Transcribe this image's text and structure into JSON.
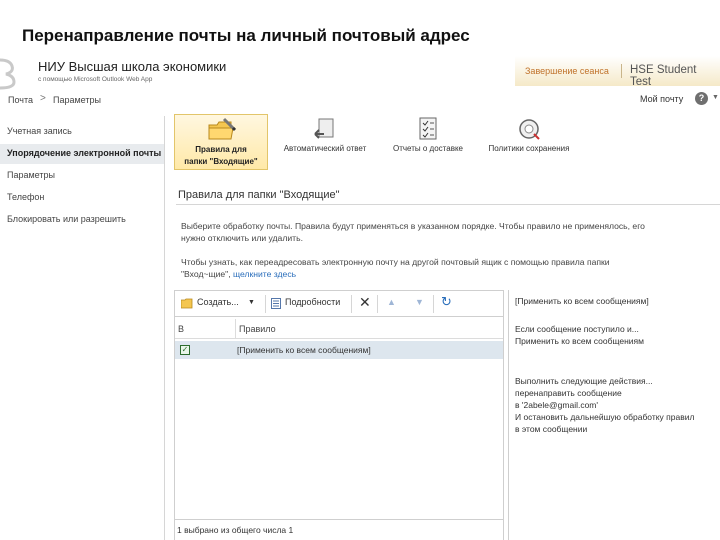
{
  "slide_title": "Перенаправление почты на личный почтовый адрес",
  "header": {
    "org_name": "НИУ Высшая школа экономики",
    "org_sub": "с помощью Microsoft Outlook Web App",
    "signout": "Завершение сеанса",
    "user": "HSE Student Test"
  },
  "nav": {
    "crumb_mail": "Почта",
    "crumb_sep": ">",
    "crumb_options": "Параметры",
    "my_mailbox": "Мой почту",
    "help": "?"
  },
  "sidebar": {
    "items": [
      {
        "label": "Учетная запись"
      },
      {
        "label": "Упорядочение электронной почты",
        "active": true
      },
      {
        "label": "Параметры"
      },
      {
        "label": "Телефон"
      },
      {
        "label": "Блокировать или разрешить"
      }
    ]
  },
  "toolbar": {
    "buttons": [
      {
        "label_line1": "Правила для",
        "label_line2": "папки \"Входящие\"",
        "icon": "folder-rules-icon",
        "selected": true
      },
      {
        "label_line1": "Автоматический ответ",
        "label_line2": "",
        "icon": "auto-reply-icon"
      },
      {
        "label_line1": "Отчеты о доставке",
        "label_line2": "",
        "icon": "delivery-report-icon"
      },
      {
        "label_line1": "Политики сохранения",
        "label_line2": "",
        "icon": "retention-policy-icon"
      }
    ]
  },
  "content": {
    "title": "Правила для папки \"Входящие\"",
    "para1_line1": "Выберите обработку почты. Правила будут применяться в указанном порядке. Чтобы правило не применялось, его",
    "para1_line2": "нужно отключить или удалить.",
    "para2_line1": "Чтобы узнать, как переадресовать электронную почту на другой почтовый ящик с помощью правила папки",
    "para2_line2_prefix": "\"Вход~щие\",",
    "para2_link": "щелкните здесь"
  },
  "list": {
    "toolbar": {
      "new_label": "Создать...",
      "details_label": "Подробности"
    },
    "columns": {
      "enabled": "В",
      "rule": "Правило"
    },
    "rows": [
      {
        "enabled": true,
        "text": "[Применить ко всем сообщениям]"
      }
    ],
    "footer": "1 выбрано из общего числа 1"
  },
  "detail": {
    "title": "[Применить ко всем сообщениям]",
    "cond_header": "Если сообщение поступило и...",
    "cond_value": "Применить ко всем сообщениям",
    "act_header": "Выполнить следующие действия...",
    "act_1": "перенаправить сообщение",
    "act_2": "в '2abele@gmail.com'",
    "act_3": "И остановить дальнейшую обработку правил",
    "act_4": "в этом сообщении"
  },
  "colors": {
    "signout": "#c0722a",
    "link": "#2a6ebb",
    "selected_row": "#dde6ee",
    "selected_tab": "#ffe9a8"
  }
}
